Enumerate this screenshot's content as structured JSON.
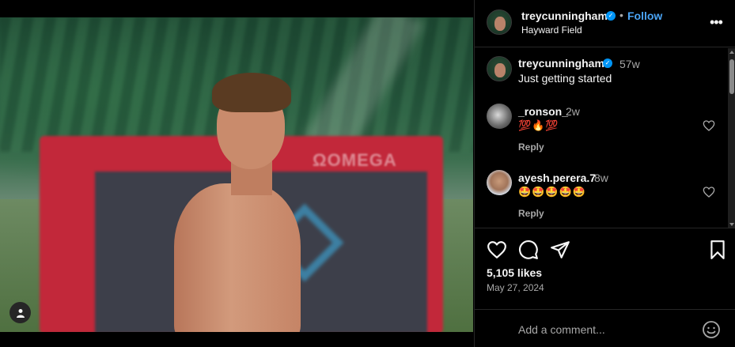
{
  "post": {
    "author": "treycunningham",
    "verified": true,
    "follow_label": "Follow",
    "dot": "•",
    "location": "Hayward Field",
    "more_label": "•••"
  },
  "photo": {
    "board_text": "ΩOMEGA"
  },
  "caption": {
    "username": "treycunningham",
    "time": "57w",
    "text": "Just getting started"
  },
  "comments": [
    {
      "username": "_ronson_",
      "time": "2w",
      "text": "💯🔥💯",
      "reply_label": "Reply"
    },
    {
      "username": "ayesh.perera.7",
      "time": "8w",
      "text": "🤩🤩🤩🤩🤩",
      "reply_label": "Reply"
    }
  ],
  "stats": {
    "likes": "5,105 likes",
    "date": "May 27, 2024"
  },
  "add_comment": {
    "placeholder": "Add a comment..."
  },
  "icons": {
    "like": "heart-icon",
    "comment": "comment-icon",
    "share": "paper-plane-icon",
    "save": "bookmark-icon",
    "emoji": "smiley-icon",
    "user_tags": "user-icon"
  },
  "colors": {
    "background": "#000000",
    "accent": "#0095f6",
    "follow": "#4aa4f5",
    "muted_text": "#a8a8a8"
  }
}
